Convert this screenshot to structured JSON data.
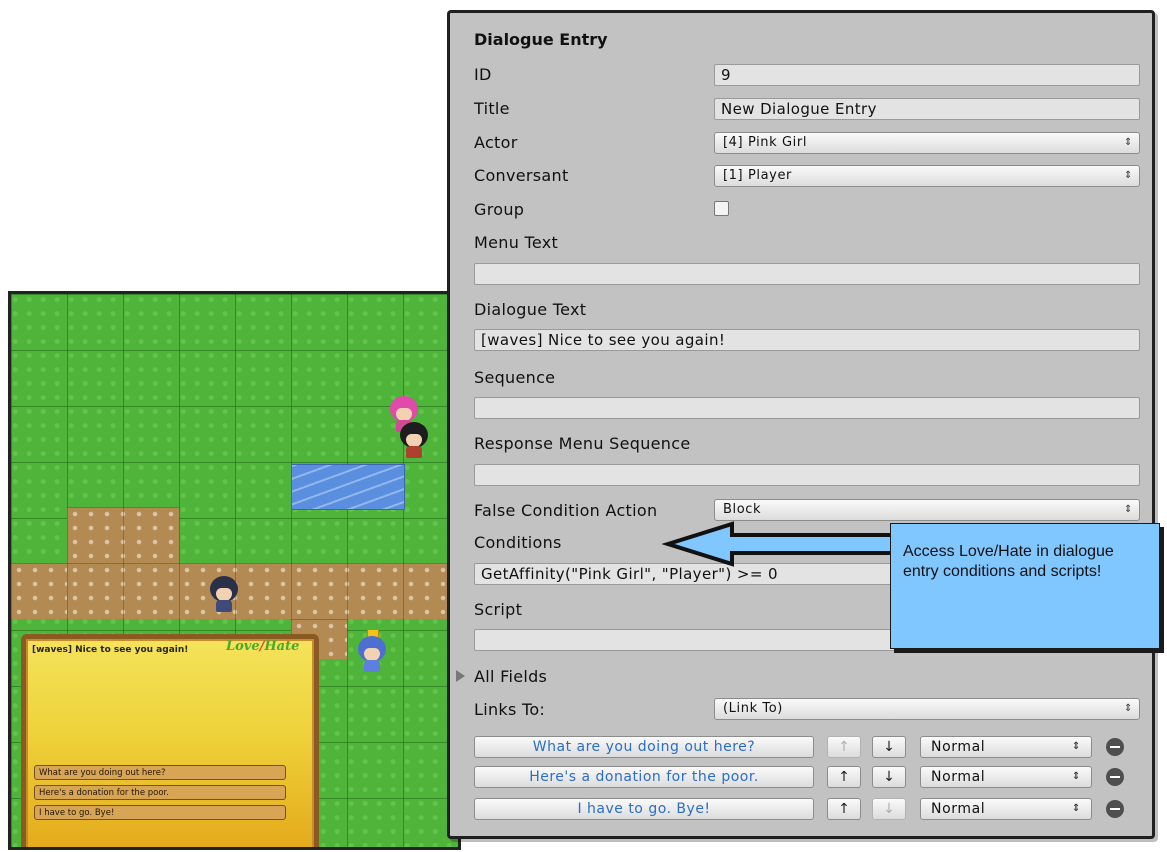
{
  "game": {
    "dialogue_line": "[waves] Nice to see you again!",
    "logo": {
      "part1": "Love",
      "part2": "Hate"
    },
    "responses": [
      "What are you doing out here?",
      "Here's a donation for the poor.",
      "I have to go. Bye!"
    ]
  },
  "inspector": {
    "heading": "Dialogue Entry",
    "labels": {
      "id": "ID",
      "title": "Title",
      "actor": "Actor",
      "conversant": "Conversant",
      "group": "Group",
      "menu_text": "Menu Text",
      "dialogue_text": "Dialogue Text",
      "sequence": "Sequence",
      "response_menu_sequence": "Response Menu Sequence",
      "false_condition_action": "False Condition Action",
      "conditions": "Conditions",
      "script": "Script",
      "all_fields": "All Fields",
      "links_to": "Links To:"
    },
    "values": {
      "id": "9",
      "title": "New Dialogue Entry",
      "actor": "[4] Pink Girl",
      "conversant": "[1] Player",
      "group_checked": false,
      "menu_text": "",
      "dialogue_text": "[waves] Nice to see you again!",
      "sequence": "",
      "response_menu_sequence": "",
      "false_condition_action": "Block",
      "conditions": "GetAffinity(\"Pink Girl\", \"Player\") >= 0",
      "script": "",
      "links_to": "(Link To)"
    },
    "links": [
      {
        "text": "What are you doing out here?",
        "priority": "Normal",
        "up": "↑",
        "down": "↓"
      },
      {
        "text": "Here's a donation for the poor.",
        "priority": "Normal",
        "up": "↑",
        "down": "↓"
      },
      {
        "text": "I have to go. Bye!",
        "priority": "Normal",
        "up": "↑",
        "down": "↓"
      }
    ],
    "dropdown_glyph": "⇕"
  },
  "callout": {
    "text": "Access Love/Hate in dialogue entry conditions and scripts!",
    "color": "#80c6ff"
  },
  "colors": {
    "grass": "#4fb43a",
    "dirt": "#b38a52",
    "water": "#5a8fe0",
    "inspector_bg": "#c2c2c2",
    "link_text": "#2b6ec7"
  }
}
